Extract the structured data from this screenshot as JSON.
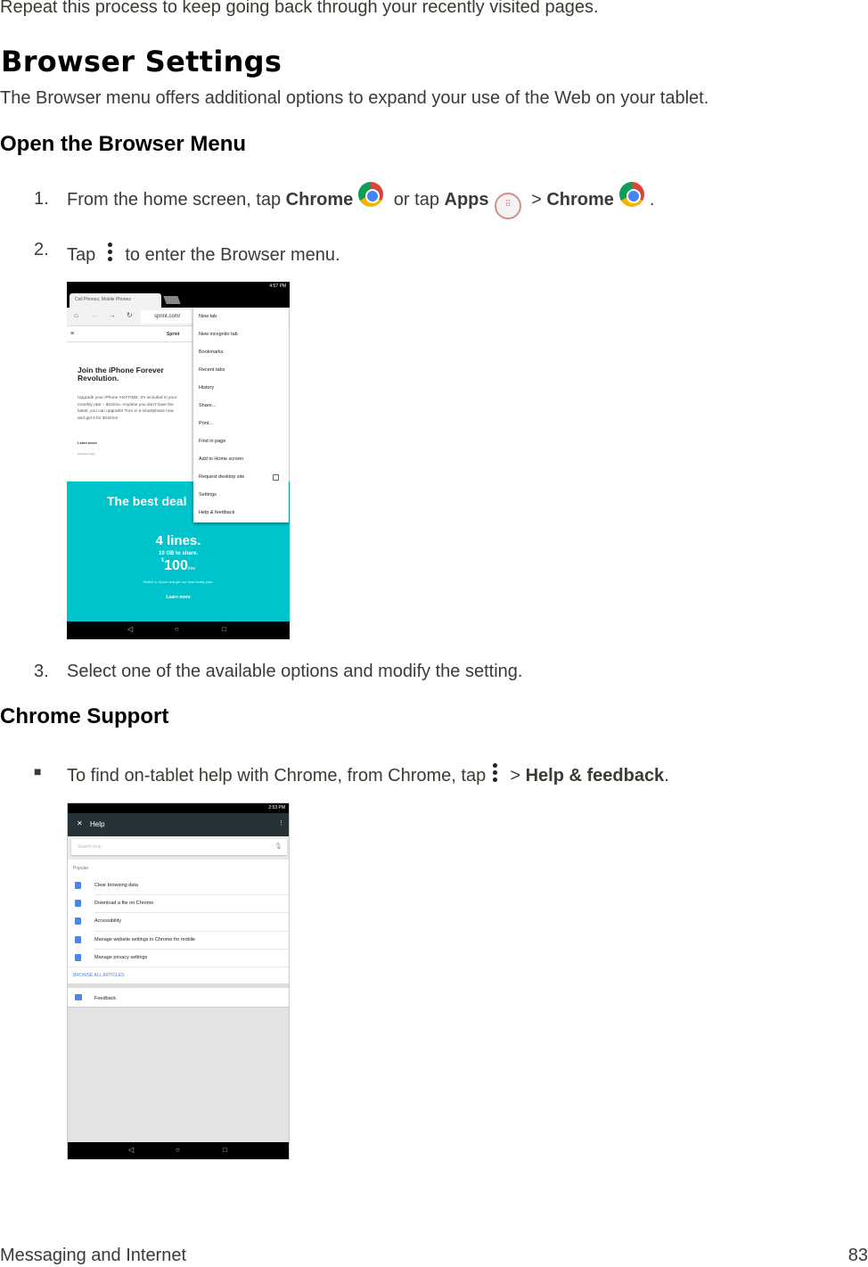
{
  "intro_text": "Repeat this process to keep going back through your recently visited pages.",
  "title": "Browser Settings",
  "subtitle": "The Browser menu offers additional options to expand your use of the Web on your tablet.",
  "section1": {
    "heading": "Open the Browser Menu",
    "step1": {
      "num": "1.",
      "a": "From the home screen, tap ",
      "b": "Chrome",
      "c": " or tap ",
      "d": "Apps",
      "e": " > ",
      "f": "Chrome",
      "g": "."
    },
    "step2": {
      "num": "2.",
      "a": "Tap ",
      "b": " to enter the Browser menu."
    },
    "step3": {
      "num": "3.",
      "text": "Select one of the available options and modify the setting."
    }
  },
  "screenshot1": {
    "time": "4:57 PM",
    "tab_title": "Cell Phones, Mobile Phones",
    "url": "sprint.com/",
    "brand": "Sprint",
    "headline": "Join the iPhone Forever Revolution.",
    "body": "Upgrade your iPhone ANYTIME. It's included in your monthly rate – $22/mo. Anytime you don't have the latest, you can upgrade! Turn in a smartphone now and get it for $15/mo!",
    "learn_more": "Learn more",
    "restrictions": "Restrictions apply.",
    "banner_title": "The best deal",
    "banner_lines": "4 lines.",
    "banner_share": "10 GB to share.",
    "banner_price": "100",
    "banner_currency": "$",
    "banner_unit": "/mo",
    "banner_sub": "Switch to Sprint and get our best family plan.",
    "banner_learn": "Learn more",
    "menu": [
      "New tab",
      "New incognito tab",
      "Bookmarks",
      "Recent tabs",
      "History",
      "Share...",
      "Print...",
      "Find in page",
      "Add to Home screen",
      "Request desktop site",
      "Settings",
      "Help & feedback"
    ],
    "teal": "#00c4cc"
  },
  "section2": {
    "heading": "Chrome Support",
    "bullet": "■",
    "a": "To find on-tablet help with Chrome, from Chrome, tap ",
    "b": " > ",
    "c": "Help & feedback",
    "d": "."
  },
  "screenshot2": {
    "time": "2:53 PM",
    "title": "Help",
    "search_placeholder": "Search help",
    "popular": "Popular",
    "items": [
      "Clear browsing data",
      "Download a file on Chrome",
      "Accessibility",
      "Manage website settings in Chrome for mobile",
      "Manage privacy settings"
    ],
    "browse_all": "BROWSE ALL ARTICLES",
    "feedback": "Feedback"
  },
  "footer": {
    "left": "Messaging and Internet",
    "page": "83"
  }
}
